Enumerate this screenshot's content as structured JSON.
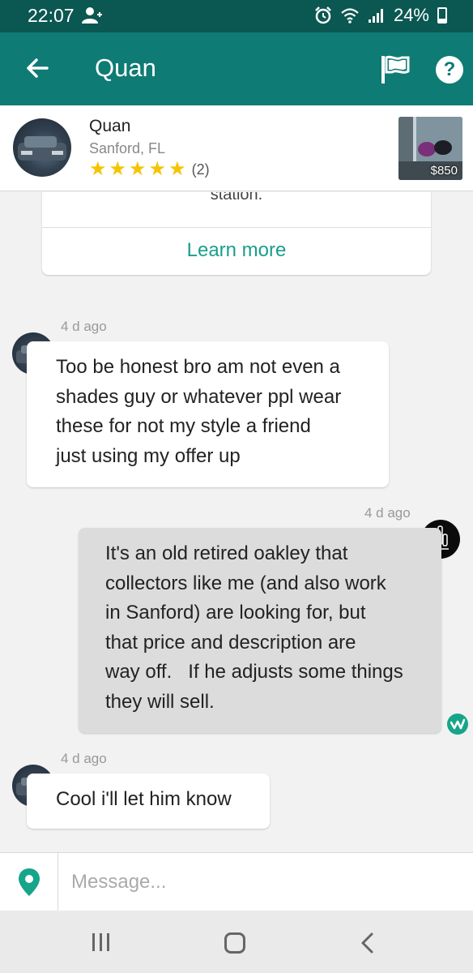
{
  "status_bar": {
    "time": "22:07",
    "battery": "24%"
  },
  "header": {
    "title": "Quan"
  },
  "seller": {
    "name": "Quan",
    "location": "Sanford, FL",
    "rating_stars": 5,
    "rating_count": "(2)",
    "item_price": "$850"
  },
  "promo": {
    "cut_text": "station.",
    "learn_more": "Learn more"
  },
  "messages": [
    {
      "time": "4 d ago",
      "lines": [
        "Too be honest bro am not even a",
        "shades guy or whatever ppl wear",
        "these for not my style a friend",
        "just using my offer up"
      ]
    },
    {
      "time": "4 d ago",
      "lines": [
        "It's an old retired oakley that",
        "collectors like me (and also work",
        "in Sanford) are looking for, but",
        "that price and description are",
        "way off.   If he adjusts some things",
        "they will sell."
      ]
    },
    {
      "time": "4 d ago",
      "lines": [
        "Cool i'll let him know"
      ]
    }
  ],
  "composer": {
    "placeholder": "Message..."
  },
  "colors": {
    "status_bar": "#0b5752",
    "app_bar": "#0e7b74",
    "accent": "#199e8c",
    "star": "#f5c400",
    "outgoing_bubble": "#dcdcdc"
  }
}
